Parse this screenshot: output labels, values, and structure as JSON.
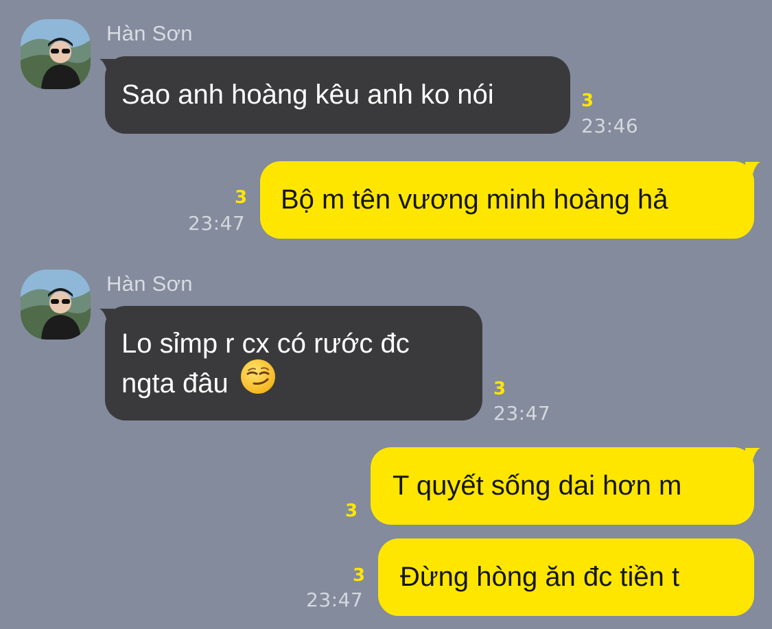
{
  "messages": [
    {
      "sender": "Hàn Sơn",
      "text": "Sao anh hoàng kêu anh ko nói",
      "unread": "3",
      "time": "23:46"
    },
    {
      "text": "Bộ m tên vương minh hoàng hả",
      "unread": "3",
      "time": "23:47"
    },
    {
      "sender": "Hàn Sơn",
      "line1": "Lo sỉmp r cx có rước đc",
      "line2": "ngta đâu",
      "emoji": "smirking-face",
      "unread": "3",
      "time": "23:47"
    },
    {
      "text": "T quyết sống dai hơn m",
      "unread": "3"
    },
    {
      "text": "Đừng hòng ăn đc tiền t",
      "unread": "3",
      "time": "23:47"
    }
  ],
  "colors": {
    "background": "#838B9C",
    "incoming_bubble": "#3A3A3C",
    "outgoing_bubble": "#FFE600",
    "unread_count": "#FFE600"
  }
}
